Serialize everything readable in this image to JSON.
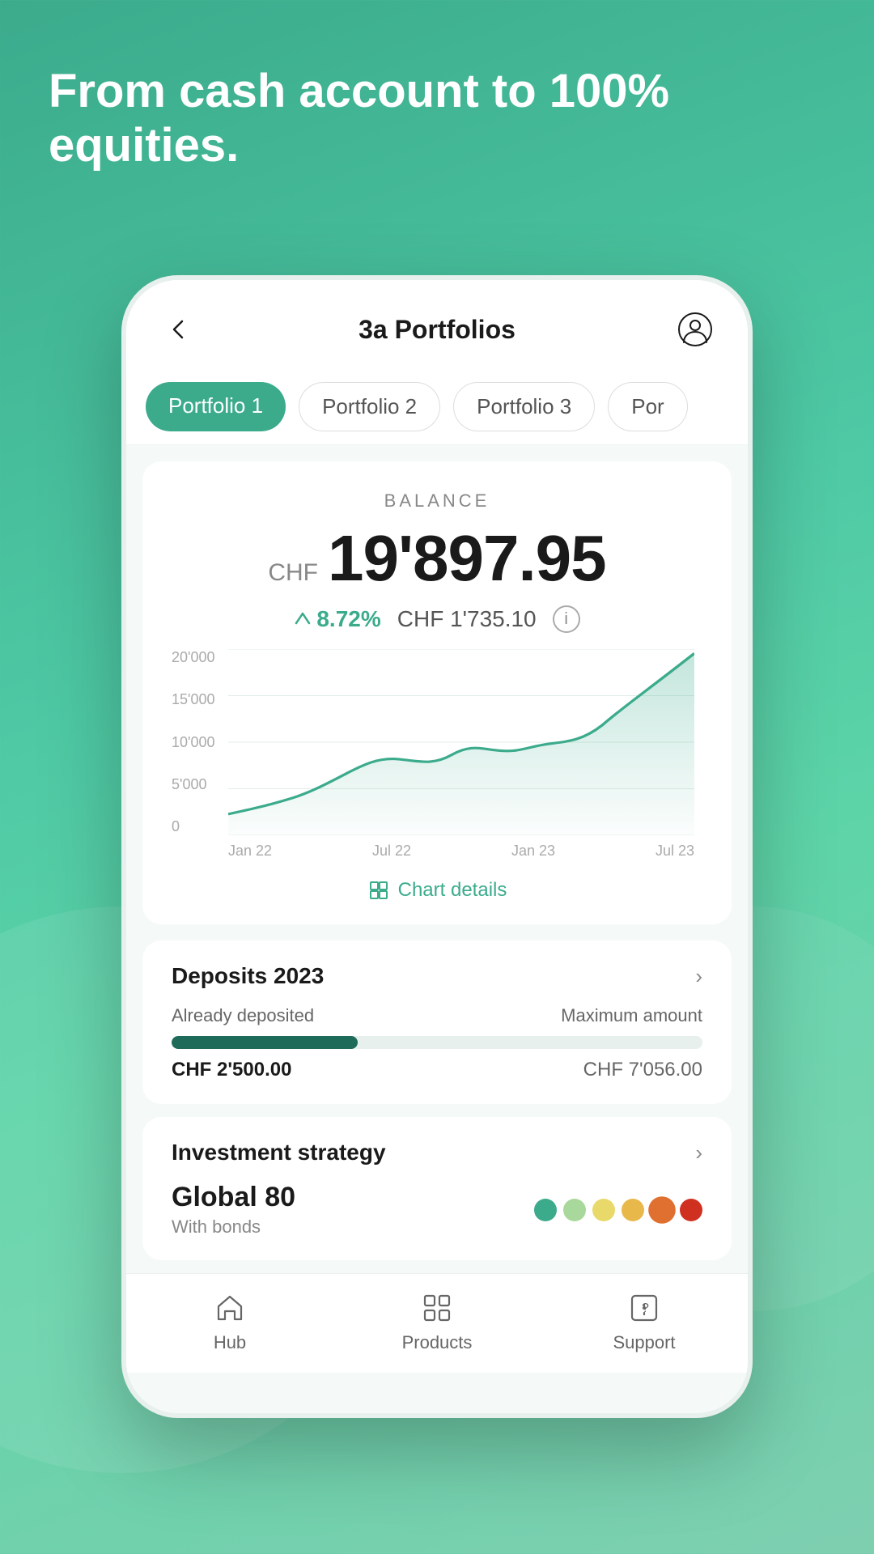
{
  "hero": {
    "text": "From cash account to 100% equities."
  },
  "header": {
    "title": "3a Portfolios",
    "back_label": "back",
    "profile_label": "profile"
  },
  "tabs": [
    {
      "label": "Portfolio 1",
      "active": true
    },
    {
      "label": "Portfolio 2",
      "active": false
    },
    {
      "label": "Portfolio 3",
      "active": false
    },
    {
      "label": "Por...",
      "active": false
    }
  ],
  "balance": {
    "label": "BALANCE",
    "currency": "CHF",
    "value": "19'897.95",
    "change_percent": "8.72%",
    "change_amount": "CHF 1'735.10",
    "info": "i"
  },
  "chart": {
    "y_labels": [
      "20'000",
      "15'000",
      "10'000",
      "5'000",
      "0"
    ],
    "x_labels": [
      "Jan 22",
      "Jul 22",
      "Jan 23",
      "Jul 23"
    ],
    "details_label": "Chart details"
  },
  "deposits_card": {
    "title": "Deposits 2023",
    "already_label": "Already deposited",
    "max_label": "Maximum amount",
    "deposited_value": "CHF 2'500.00",
    "max_value": "CHF 7'056.00",
    "progress_percent": 35
  },
  "strategy_card": {
    "title": "Investment strategy",
    "strategy_name": "Global 80",
    "strategy_sub": "With bonds",
    "risk_dots": [
      {
        "color": "#3bab8c"
      },
      {
        "color": "#a8d89c"
      },
      {
        "color": "#e8d96a"
      },
      {
        "color": "#e8b84a"
      },
      {
        "color": "#e07030"
      },
      {
        "color": "#d03020"
      }
    ]
  },
  "bottom_nav": [
    {
      "label": "Hub",
      "icon": "home-icon",
      "active": false
    },
    {
      "label": "Products",
      "icon": "products-icon",
      "active": false
    },
    {
      "label": "Support",
      "icon": "support-icon",
      "active": false
    }
  ]
}
